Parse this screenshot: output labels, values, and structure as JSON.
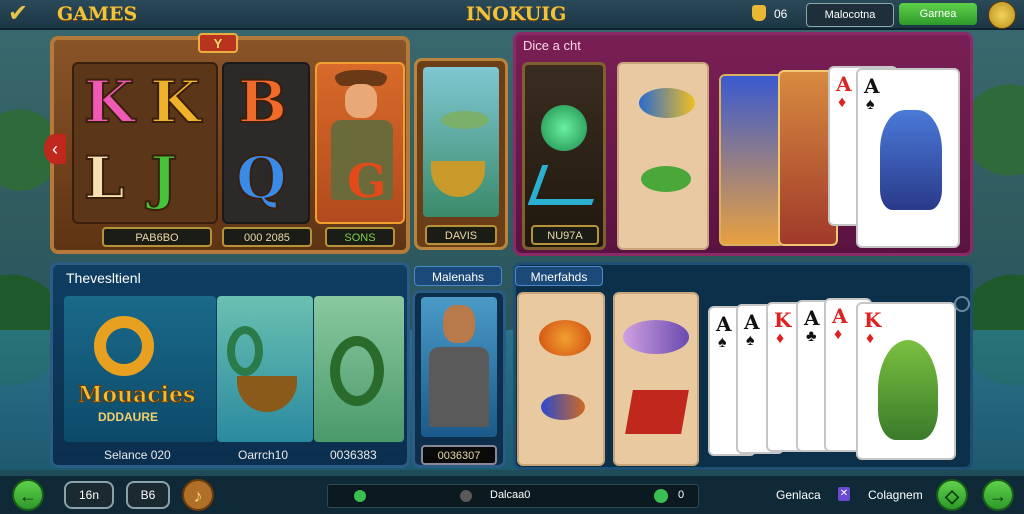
{
  "topbar": {
    "games_label": "GAMES",
    "app_title": "INOKUIG",
    "coin_count": "06",
    "dark_button": "Malocotna",
    "green_button": "Garnea"
  },
  "wood_panel": {
    "letters": [
      "K",
      "K",
      "L",
      "J"
    ],
    "letters2": [
      "B",
      "Q"
    ],
    "plates": [
      "PAB6BO",
      "000 2085",
      "SONS"
    ],
    "badge": "Y"
  },
  "fish_panel": {
    "plate": "DAVIS"
  },
  "purple_panel": {
    "title": "Dice a cht",
    "green_plate": "NU97A"
  },
  "blue_panel": {
    "title": "Thevesltienl",
    "logo_text": "Mouacies",
    "logo_sub": "DDDAURE",
    "captions": [
      "Selance 020",
      "Oarrch10",
      "0036383"
    ]
  },
  "portrait_panel": {
    "header": "Malenahs",
    "caption": "0036307"
  },
  "deck_panel": {
    "header": "Mnerfahds",
    "cards": [
      {
        "rank": "A",
        "suit": "♠",
        "color": "#111"
      },
      {
        "rank": "A",
        "suit": "♠",
        "color": "#111"
      },
      {
        "rank": "K",
        "suit": "♦",
        "color": "#d22"
      },
      {
        "rank": "A",
        "suit": "♣",
        "color": "#111"
      },
      {
        "rank": "A",
        "suit": "♦",
        "color": "#d22"
      },
      {
        "rank": "K",
        "suit": "♦",
        "color": "#d22"
      }
    ],
    "top_cards": [
      {
        "rank": "A",
        "suit": "♦",
        "color": "#d22"
      },
      {
        "rank": "A",
        "suit": "♠",
        "color": "#111"
      }
    ]
  },
  "bottombar": {
    "btn1": "16n",
    "btn2": "B6",
    "slider_label": "Dalcaa0",
    "slider_right": "0",
    "text_left": "Genlaca",
    "text_right": "Colagnem"
  }
}
